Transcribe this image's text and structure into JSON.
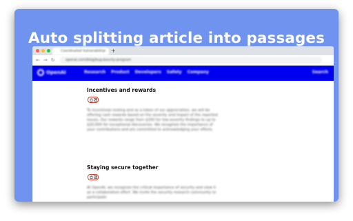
{
  "headline": "Auto splitting article into passages",
  "browser": {
    "tab_title": "Coordinated Vulnerability Disclosure",
    "url": "openai.com/blog/bug-bounty-program"
  },
  "site": {
    "logo_text": "OpenAI",
    "menu": [
      "Research",
      "Product",
      "Developers",
      "Safety",
      "Company"
    ],
    "search": "Search"
  },
  "sections": [
    {
      "title": "Incentives and rewards",
      "paragraph": "To incentivize testing and as a token of our appreciation, we will be offering cash rewards based on the severity and impact of the reported issues. Our rewards range from $200 for low-severity findings to up to $20,000 for exceptional discoveries. We recognize the importance of your contributions and are committed to acknowledging your efforts."
    },
    {
      "title": "Staying secure together",
      "paragraph": "At OpenAI, we recognize the critical importance of security and view it as a collaborative effort. We invite the security research community to participate"
    }
  ],
  "icons": {
    "copy": "copy-icon",
    "split": "split-passage-icon"
  },
  "colors": {
    "card_bg": "#6f93ee",
    "site_nav": "#0000f0",
    "button_border": "#d23a2c"
  }
}
